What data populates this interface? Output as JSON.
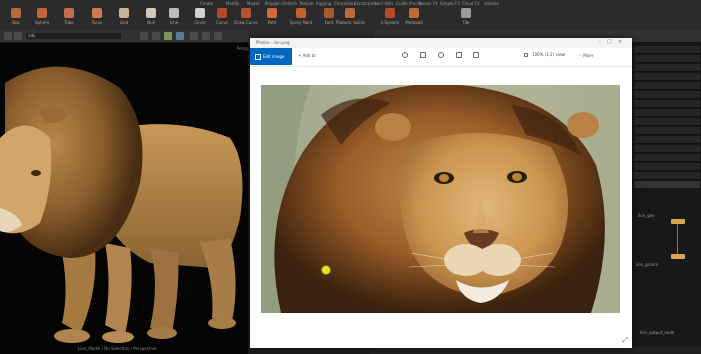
{
  "shelf": {
    "tabs": [
      "Create",
      "Modify",
      "Model",
      "Polygon",
      "Deform",
      "Texture",
      "Rigging",
      "Characters",
      "Constraints",
      "Hair Utils",
      "Guide Process",
      "Terrain FX",
      "Simple FX",
      "Cloud FX",
      "Volume"
    ],
    "tools": [
      {
        "label": "Box",
        "icon": "box-icon",
        "color": "#b86a3a"
      },
      {
        "label": "Sphere",
        "icon": "sphere-icon",
        "color": "#c4643a"
      },
      {
        "label": "Tube",
        "icon": "tube-icon",
        "color": "#c76b4a"
      },
      {
        "label": "Torus",
        "icon": "torus-icon",
        "color": "#d17a52"
      },
      {
        "label": "Grid",
        "icon": "grid-icon",
        "color": "#c9b39a"
      },
      {
        "label": "Null",
        "icon": "null-icon",
        "color": "#cfc8bd"
      },
      {
        "label": "Line",
        "icon": "line-icon",
        "color": "#bbbbbb"
      },
      {
        "label": "Circle",
        "icon": "circle-icon",
        "color": "#d0d0d0"
      },
      {
        "label": "Curve",
        "icon": "curve-icon",
        "color": "#b24a2a"
      },
      {
        "label": "Draw Curve",
        "icon": "draw-curve-icon",
        "color": "#b5542e"
      },
      {
        "label": "Path",
        "icon": "path-icon",
        "color": "#d06a36"
      },
      {
        "label": "Spray Paint",
        "icon": "spray-paint-icon",
        "color": "#c3602e"
      },
      {
        "label": "Font",
        "icon": "font-icon",
        "color": "#a65a30"
      },
      {
        "label": "Platonic Solids",
        "icon": "platonic-icon",
        "color": "#b86a3a"
      },
      {
        "label": "L-System",
        "icon": "l-system-icon",
        "color": "#b64a2a"
      },
      {
        "label": "Metaball",
        "icon": "metaball-icon",
        "color": "#c06a3a"
      },
      {
        "label": "File",
        "icon": "file-icon",
        "color": "#9a9a9a"
      }
    ]
  },
  "viewer": {
    "path": "/obj",
    "label": "Persp",
    "status": "Lion_Model / No Selection / Perspective"
  },
  "photo_window": {
    "title": "Photos - lion.png",
    "edit_label": "Edit image",
    "add_label": "Add to",
    "zoom": "100% (1:1) view",
    "more_label": "More"
  },
  "network": {
    "node_a_label": "lion_geo",
    "node_b_label": "lion_groom",
    "status_label": "lion_output_node"
  },
  "colors": {
    "accent": "#0067c0",
    "node": "#d8a850"
  }
}
